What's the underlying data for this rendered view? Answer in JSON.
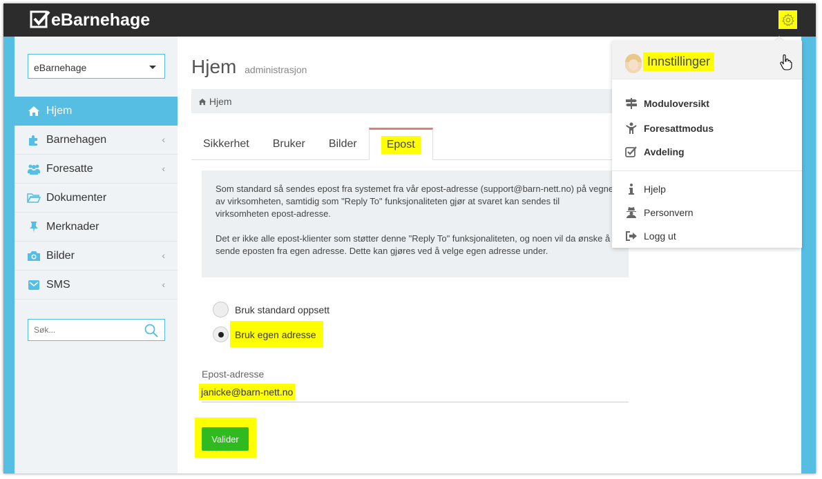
{
  "app": {
    "logo_text": "eBarnehage"
  },
  "sidebar": {
    "select_value": "eBarnehage",
    "items": [
      {
        "label": "Hjem",
        "icon": "home-icon",
        "active": true
      },
      {
        "label": "Barnehagen",
        "icon": "puzzle-icon",
        "has_children": true
      },
      {
        "label": "Foresatte",
        "icon": "users-icon",
        "has_children": true
      },
      {
        "label": "Dokumenter",
        "icon": "folder-icon"
      },
      {
        "label": "Merknader",
        "icon": "pin-icon"
      },
      {
        "label": "Bilder",
        "icon": "camera-icon",
        "has_children": true
      },
      {
        "label": "SMS",
        "icon": "envelope-icon",
        "has_children": true
      }
    ],
    "search_placeholder": "Søk..."
  },
  "page": {
    "title": "Hjem",
    "subtitle": "administrasjon",
    "breadcrumb": "Hjem"
  },
  "tabs": [
    {
      "label": "Sikkerhet"
    },
    {
      "label": "Bruker"
    },
    {
      "label": "Bilder"
    },
    {
      "label": "Epost",
      "active": true
    }
  ],
  "info": {
    "paragraph1": "Som standard så sendes epost fra systemet fra vår epost-adresse (support@barn-nett.no) på vegne av virksomheten, samtidig som \"Reply To\" funksjonaliteten gjør at svaret kan sendes til virksomheten epost-adresse.",
    "paragraph2": "Det er ikke alle epost-klienter som støtter denne \"Reply To\" funksjonaliteten, og noen vil da ønske å sende eposten fra egen adresse. Dette kan gjøres ved å velge egen adresse under."
  },
  "form": {
    "radio_standard": "Bruk standard oppsett",
    "radio_custom": "Bruk egen adresse",
    "selected_option": "Bruk egen adresse",
    "field_label": "Epost-adresse",
    "field_value": "janicke@barn-nett.no",
    "submit_label": "Valider"
  },
  "dropdown": {
    "title": "Innstillinger",
    "items": [
      {
        "label": "Moduloversikt",
        "icon": "signpost-icon",
        "bold": true
      },
      {
        "label": "Foresattmodus",
        "icon": "child-icon",
        "bold": true
      },
      {
        "label": "Avdeling",
        "icon": "check-square-icon",
        "bold": true
      },
      {
        "label": "Hjelp",
        "icon": "info-icon"
      },
      {
        "label": "Personvern",
        "icon": "user-secret-icon"
      },
      {
        "label": "Logg ut",
        "icon": "sign-out-icon"
      }
    ]
  },
  "colors": {
    "topbar": "#2c2c2c",
    "accent": "#56bde3",
    "highlight": "#ffff00",
    "button": "#2fba20",
    "active_tab_border": "#e27c7c"
  }
}
